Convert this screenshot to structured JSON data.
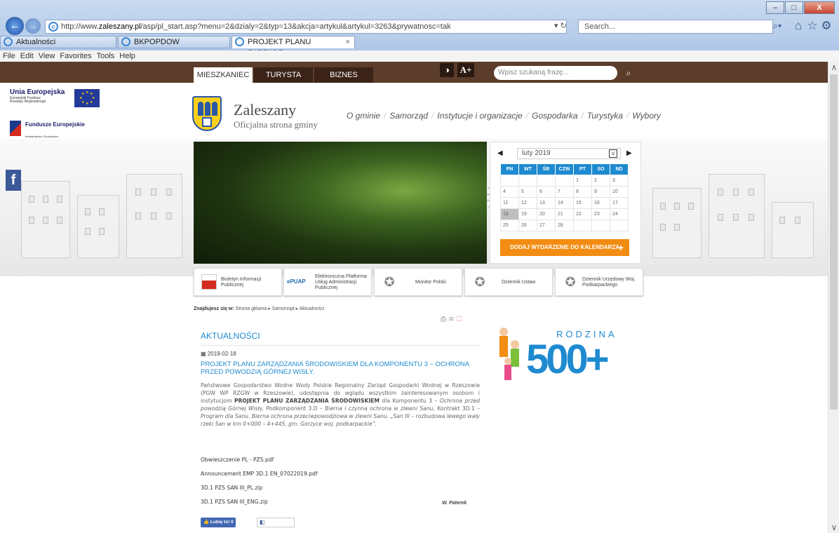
{
  "browser": {
    "url_prefix": "http://www.",
    "url_domain": "zaleszany.pl",
    "url_path": "/asp/pl_start.asp?menu=2&dzialy=2&typ=13&akcja=artykul&artykul=3263&prywatnosc=tak",
    "search_placeholder": "Search...",
    "tabs": [
      {
        "label": "Aktualności"
      },
      {
        "label": "BKPOPDOW"
      },
      {
        "label": "PROJEKT PLANU ZARZĄDZ..."
      }
    ],
    "menu": [
      "File",
      "Edit",
      "View",
      "Favorites",
      "Tools",
      "Help"
    ]
  },
  "site": {
    "top_tabs": [
      "MIESZKANIEC",
      "TURYSTA",
      "BIZNES"
    ],
    "font_size_button": "A+",
    "search_placeholder": "Wpisz szukaną frazę...",
    "name": "Zaleszany",
    "subtitle": "Oficjalna strona gminy",
    "nav": [
      "O gminie",
      "Samorząd",
      "Instytucje i organizacje",
      "Gospodarka",
      "Turystyka",
      "Wybory"
    ],
    "eu_logo": {
      "title": "Unia Europejska",
      "fund": "Europejski Fundusz Rozwoju Regionalnego",
      "fe_name": "Fundusze Europejskie",
      "fe_sub": "Infrastruktura i Środowisko"
    },
    "facebook_glyph": "f"
  },
  "calendar": {
    "month": "luty 2019",
    "weekdays": [
      "PN",
      "WT",
      "ŚR",
      "CZW",
      "PT",
      "SO",
      "ND"
    ],
    "weeks": [
      [
        "",
        "",
        "",
        "",
        "1",
        "2",
        "3"
      ],
      [
        "4",
        "5",
        "6",
        "7",
        "8",
        "9",
        "10"
      ],
      [
        "11",
        "12",
        "13",
        "14",
        "15",
        "16",
        "17"
      ],
      [
        "18",
        "19",
        "20",
        "21",
        "22",
        "23",
        "24"
      ],
      [
        "25",
        "26",
        "27",
        "28",
        "",
        "",
        ""
      ]
    ],
    "today": "18",
    "add_event": "DODAJ WYDARZENIE DO KALENDARZA"
  },
  "portals": [
    {
      "label": "Biuletyn Informacji Publicznej",
      "icon": "bip-icon"
    },
    {
      "label": "Elektroniczna Platforma Usług Administracji Publicznej",
      "icon": "epuap-icon"
    },
    {
      "label": "Monitor Polski",
      "icon": "eagle-icon"
    },
    {
      "label": "Dziennik Ustaw",
      "icon": "eagle-icon"
    },
    {
      "label": "Dziennik Urzędowy Woj. Podkarpackiego",
      "icon": "eagle-icon"
    }
  ],
  "breadcrumb": {
    "prefix": "Znajdujesz się w:",
    "items": [
      "Strona główna",
      "Samorząd",
      "Aktualności"
    ]
  },
  "article": {
    "section_title": "AKTUALNOŚCI",
    "date": "2019-02-18",
    "title": "PROJEKT PLANU ZARZĄDZANIA ŚRODOWISKIEM DLA KOMPONENTU 3 – OCHRONA PRZED POWODZIĄ GÓRNEJ WISŁY.",
    "body_part1": "Państwowe Gospodarstwo Wodne Wody Polskie Regionalny Zarząd Gospodarki Wodnej w Rzeszowie (PGW WP RZGW w Rzeszowie), udostępnia do wglądu wszystkim zainteresowanym osobom i instytucjom",
    "body_bold": "PROJEKT PLANU ZARZĄDZANIA ŚRODOWISKIEM",
    "body_part2": "dla Komponentu 3",
    "body_italic": "– Ochrona przed powodzią Górnej Wisły,",
    "body_part3": "Podkomponent 3.D –",
    "body_italic2": "Bierna i czynna ochrona w zlewni Sanu,",
    "body_part4": "Kontrakt 3D.1 –",
    "body_italic3": "Program dla Sanu. Bierna ochrona przeciwpowodziowa w zlewni Sanu. „San III – rozbudowa lewego wały rzeki San w km 0+000 – 4+445, gm. Gorzyce woj. podkarpackie”.",
    "files": [
      "Obwieszczenie PL - PZS.pdf",
      "Announcement EMP 3D.1 EN_07022019.pdf",
      "3D.1 PZS SAN III_PL.zip",
      "3D.1 PZS SAN III_ENG.zip"
    ],
    "author": "W. Paterek",
    "like_label": "Lubię to! 0"
  },
  "promo": {
    "number": "500+",
    "word": "RODZINA"
  }
}
